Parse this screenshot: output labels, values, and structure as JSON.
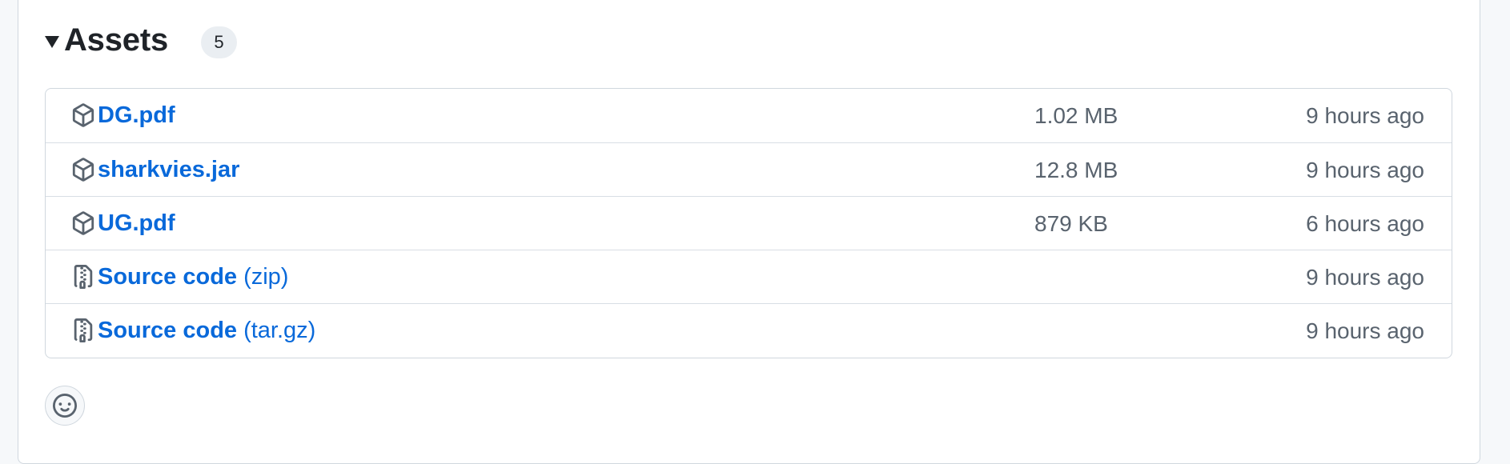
{
  "assets": {
    "title": "Assets",
    "count": "5",
    "items": [
      {
        "name": "DG.pdf",
        "suffix": "",
        "size": "1.02 MB",
        "time": "9 hours ago",
        "icon": "package-icon"
      },
      {
        "name": "sharkvies.jar",
        "suffix": "",
        "size": "12.8 MB",
        "time": "9 hours ago",
        "icon": "package-icon"
      },
      {
        "name": "UG.pdf",
        "suffix": "",
        "size": "879 KB",
        "time": "6 hours ago",
        "icon": "package-icon"
      },
      {
        "name": "Source code",
        "suffix": "(zip)",
        "size": "",
        "time": "9 hours ago",
        "icon": "file-zip-icon"
      },
      {
        "name": "Source code",
        "suffix": "(tar.gz)",
        "size": "",
        "time": "9 hours ago",
        "icon": "file-zip-icon"
      }
    ]
  },
  "reactions": {
    "icon": "smiley-icon"
  },
  "colors": {
    "link": "#0969da",
    "muted": "#59636e",
    "border": "#d0d7de"
  }
}
